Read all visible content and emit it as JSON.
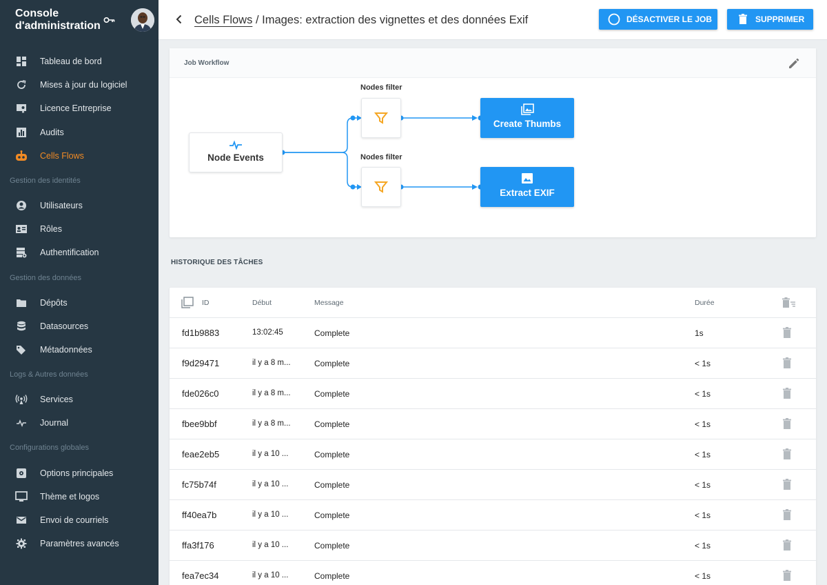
{
  "app": {
    "title": "Console d'administration"
  },
  "sidebar": {
    "groups": [
      {
        "section": "",
        "items": [
          {
            "label": "Tableau de bord",
            "icon": "dashboard-icon"
          },
          {
            "label": "Mises à jour du logiciel",
            "icon": "update-icon"
          },
          {
            "label": "Licence Entreprise",
            "icon": "license-icon"
          },
          {
            "label": "Audits",
            "icon": "chart-icon"
          },
          {
            "label": "Cells Flows",
            "icon": "robot-icon",
            "active": true
          }
        ]
      },
      {
        "section": "Gestion des identités",
        "items": [
          {
            "label": "Utilisateurs",
            "icon": "user-icon"
          },
          {
            "label": "Rôles",
            "icon": "id-card-icon"
          },
          {
            "label": "Authentification",
            "icon": "auth-server-icon"
          }
        ]
      },
      {
        "section": "Gestion des données",
        "items": [
          {
            "label": "Dépôts",
            "icon": "folder-icon"
          },
          {
            "label": "Datasources",
            "icon": "database-icon"
          },
          {
            "label": "Métadonnées",
            "icon": "tag-icon"
          }
        ]
      },
      {
        "section": "Logs & Autres données",
        "items": [
          {
            "label": "Services",
            "icon": "broadcast-icon"
          },
          {
            "label": "Journal",
            "icon": "pulse-icon"
          }
        ]
      },
      {
        "section": "Configurations globales",
        "items": [
          {
            "label": "Options principales",
            "icon": "settings-box-icon"
          },
          {
            "label": "Thème et logos",
            "icon": "monitor-icon"
          },
          {
            "label": "Envoi de courriels",
            "icon": "mail-icon"
          },
          {
            "label": "Paramètres avancés",
            "icon": "gear-icon"
          }
        ]
      }
    ]
  },
  "header": {
    "breadcrumb_link": "Cells Flows",
    "breadcrumb_rest": " / Images: extraction des vignettes et des données Exif",
    "deactivate_label": "DÉSACTIVER LE JOB",
    "delete_label": "SUPPRIMER"
  },
  "workflow": {
    "title": "Job Workflow",
    "source_label": "Node Events",
    "filter1_label": "Nodes filter",
    "filter2_label": "Nodes filter",
    "action1_label": "Create Thumbs",
    "action2_label": "Extract EXIF"
  },
  "history": {
    "title": "HISTORIQUE DES TÂCHES",
    "columns": {
      "id": "ID",
      "start": "Début",
      "message": "Message",
      "duration": "Durée"
    },
    "rows": [
      {
        "id": "fd1b9883",
        "start": "13:02:45",
        "message": "Complete",
        "duration": "1s"
      },
      {
        "id": "f9d29471",
        "start": "il y a 8 m...",
        "message": "Complete",
        "duration": "< 1s"
      },
      {
        "id": "fde026c0",
        "start": "il y a 8 m...",
        "message": "Complete",
        "duration": "< 1s"
      },
      {
        "id": "fbee9bbf",
        "start": "il y a 8 m...",
        "message": "Complete",
        "duration": "< 1s"
      },
      {
        "id": "feae2eb5",
        "start": "il y a 10 ...",
        "message": "Complete",
        "duration": "< 1s"
      },
      {
        "id": "fc75b74f",
        "start": "il y a 10 ...",
        "message": "Complete",
        "duration": "< 1s"
      },
      {
        "id": "ff40ea7b",
        "start": "il y a 10 ...",
        "message": "Complete",
        "duration": "< 1s"
      },
      {
        "id": "ffa3f176",
        "start": "il y a 10 ...",
        "message": "Complete",
        "duration": "< 1s"
      },
      {
        "id": "fea7ec34",
        "start": "il y a 10 ...",
        "message": "Complete",
        "duration": "< 1s"
      }
    ]
  },
  "colors": {
    "sidebar_bg": "#263743",
    "accent": "#2196f3",
    "active": "#f08a24",
    "filter_icon": "#f5a623"
  }
}
